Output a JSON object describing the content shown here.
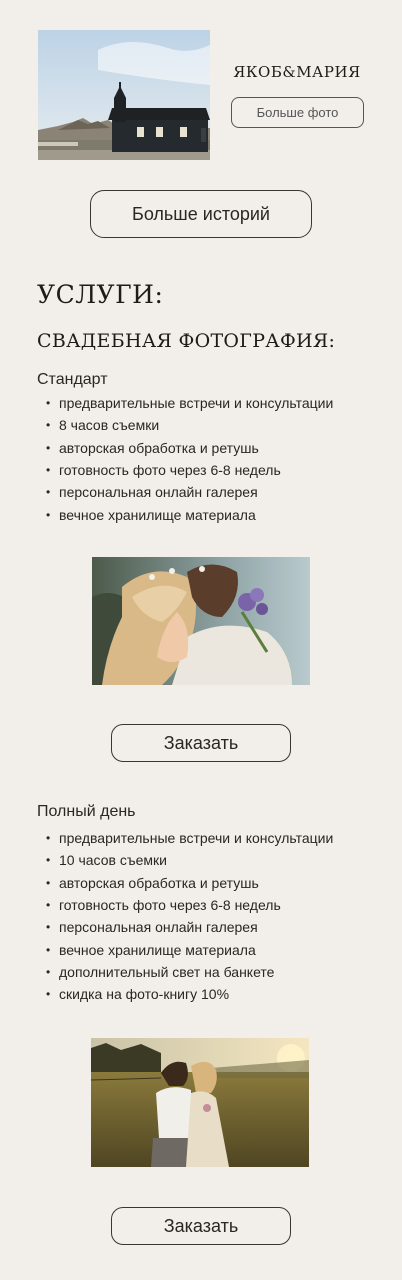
{
  "story": {
    "title": "ЯКОБ&МАРИЯ",
    "more_photos_label": "Больше фото",
    "photo_icon": "church-photo"
  },
  "more_stories_label": "Больше историй",
  "services_heading": "УСЛУГИ:",
  "wedding_heading": "СВАДЕБНАЯ ФОТОГРАФИЯ:",
  "packages": [
    {
      "name": "Стандарт",
      "items": [
        "предварительные встречи и консультации",
        "8 часов съемки",
        "авторская обработка и ретушь",
        "готовность фото через 6-8 недель",
        "персональная онлайн галерея",
        "вечное хранилище материала"
      ],
      "order_label": "Заказать"
    },
    {
      "name": "Полный день",
      "items": [
        "предварительные встречи и консультации",
        "10 часов съемки",
        "авторская обработка и ретушь",
        "готовность фото через 6-8 недель",
        "персональная онлайн галерея",
        "вечное хранилище материала",
        "дополнительный свет на банкете",
        "скидка на фото-книгу 10%"
      ],
      "order_label": "Заказать"
    }
  ],
  "colors": {
    "background": "#f2efea",
    "text": "#2a2622",
    "border": "#3a3531"
  }
}
